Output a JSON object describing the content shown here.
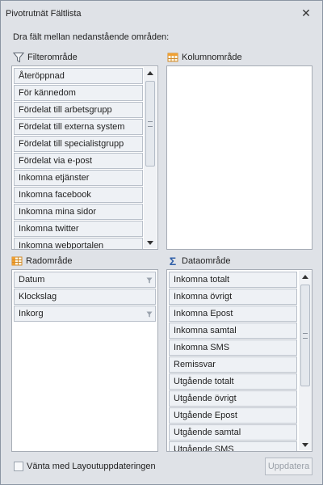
{
  "window": {
    "title": "Pivotrutnät Fältlista",
    "close_glyph": "✕",
    "instruction": "Dra fält mellan nedanstående områden:"
  },
  "filter_area": {
    "label": "Filterområde",
    "icon": "filter-icon",
    "fields": [
      "Återöppnad",
      "För kännedom",
      "Fördelat till arbetsgrupp",
      "Fördelat till externa system",
      "Fördelat till specialistgrupp",
      "Fördelat via e-post",
      "Inkomna etjänster",
      "Inkomna facebook",
      "Inkomna mina sidor",
      "Inkomna twitter",
      "Inkomna webportalen"
    ]
  },
  "column_area": {
    "label": "Kolumnområde",
    "icon": "column-table-icon",
    "fields": []
  },
  "row_area": {
    "label": "Radområde",
    "icon": "row-table-icon",
    "fields": [
      {
        "label": "Datum",
        "filtered": true
      },
      {
        "label": "Klockslag",
        "filtered": false
      },
      {
        "label": "Inkorg",
        "filtered": true
      }
    ]
  },
  "data_area": {
    "label": "Dataområde",
    "icon": "sigma-icon",
    "fields": [
      "Inkomna totalt",
      "Inkomna övrigt",
      "Inkomna Epost",
      "Inkomna samtal",
      "Inkomna SMS",
      "Remissvar",
      "Utgående totalt",
      "Utgående övrigt",
      "Utgående Epost",
      "Utgående samtal",
      "Utgående SMS"
    ]
  },
  "footer": {
    "defer_label": "Vänta med Layoutuppdateringen",
    "defer_checked": false,
    "update_label": "Uppdatera",
    "update_enabled": false
  },
  "colors": {
    "window_bg": "#dfe2e7",
    "field_bg": "#eef1f5",
    "field_border": "#b9c0ca",
    "panel_border": "#a6acb5"
  }
}
